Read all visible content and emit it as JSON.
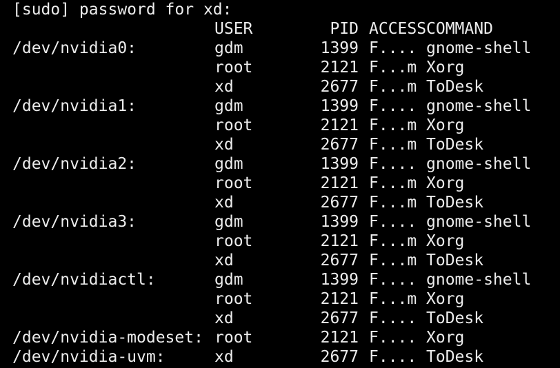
{
  "terminal": {
    "prompt": "[sudo] password for xd:",
    "header": {
      "user": "USER",
      "pid": "PID",
      "access": "ACCESS",
      "command": "COMMAND"
    },
    "rows": [
      {
        "device": "/dev/nvidia0:",
        "user": "gdm",
        "pid": "1399",
        "access": "F....",
        "command": "gnome-shell"
      },
      {
        "device": "",
        "user": "root",
        "pid": "2121",
        "access": "F...m",
        "command": "Xorg"
      },
      {
        "device": "",
        "user": "xd",
        "pid": "2677",
        "access": "F...m",
        "command": "ToDesk"
      },
      {
        "device": "/dev/nvidia1:",
        "user": "gdm",
        "pid": "1399",
        "access": "F....",
        "command": "gnome-shell"
      },
      {
        "device": "",
        "user": "root",
        "pid": "2121",
        "access": "F...m",
        "command": "Xorg"
      },
      {
        "device": "",
        "user": "xd",
        "pid": "2677",
        "access": "F...m",
        "command": "ToDesk"
      },
      {
        "device": "/dev/nvidia2:",
        "user": "gdm",
        "pid": "1399",
        "access": "F....",
        "command": "gnome-shell"
      },
      {
        "device": "",
        "user": "root",
        "pid": "2121",
        "access": "F...m",
        "command": "Xorg"
      },
      {
        "device": "",
        "user": "xd",
        "pid": "2677",
        "access": "F...m",
        "command": "ToDesk"
      },
      {
        "device": "/dev/nvidia3:",
        "user": "gdm",
        "pid": "1399",
        "access": "F....",
        "command": "gnome-shell"
      },
      {
        "device": "",
        "user": "root",
        "pid": "2121",
        "access": "F...m",
        "command": "Xorg"
      },
      {
        "device": "",
        "user": "xd",
        "pid": "2677",
        "access": "F...m",
        "command": "ToDesk"
      },
      {
        "device": "/dev/nvidiactl:",
        "user": "gdm",
        "pid": "1399",
        "access": "F....",
        "command": "gnome-shell"
      },
      {
        "device": "",
        "user": "root",
        "pid": "2121",
        "access": "F...m",
        "command": "Xorg"
      },
      {
        "device": "",
        "user": "xd",
        "pid": "2677",
        "access": "F....",
        "command": "ToDesk"
      },
      {
        "device": "/dev/nvidia-modeset:",
        "user": "root",
        "pid": "2121",
        "access": "F....",
        "command": "Xorg"
      },
      {
        "device": "/dev/nvidia-uvm:",
        "user": "xd",
        "pid": "2677",
        "access": "F....",
        "command": "ToDesk"
      }
    ]
  }
}
